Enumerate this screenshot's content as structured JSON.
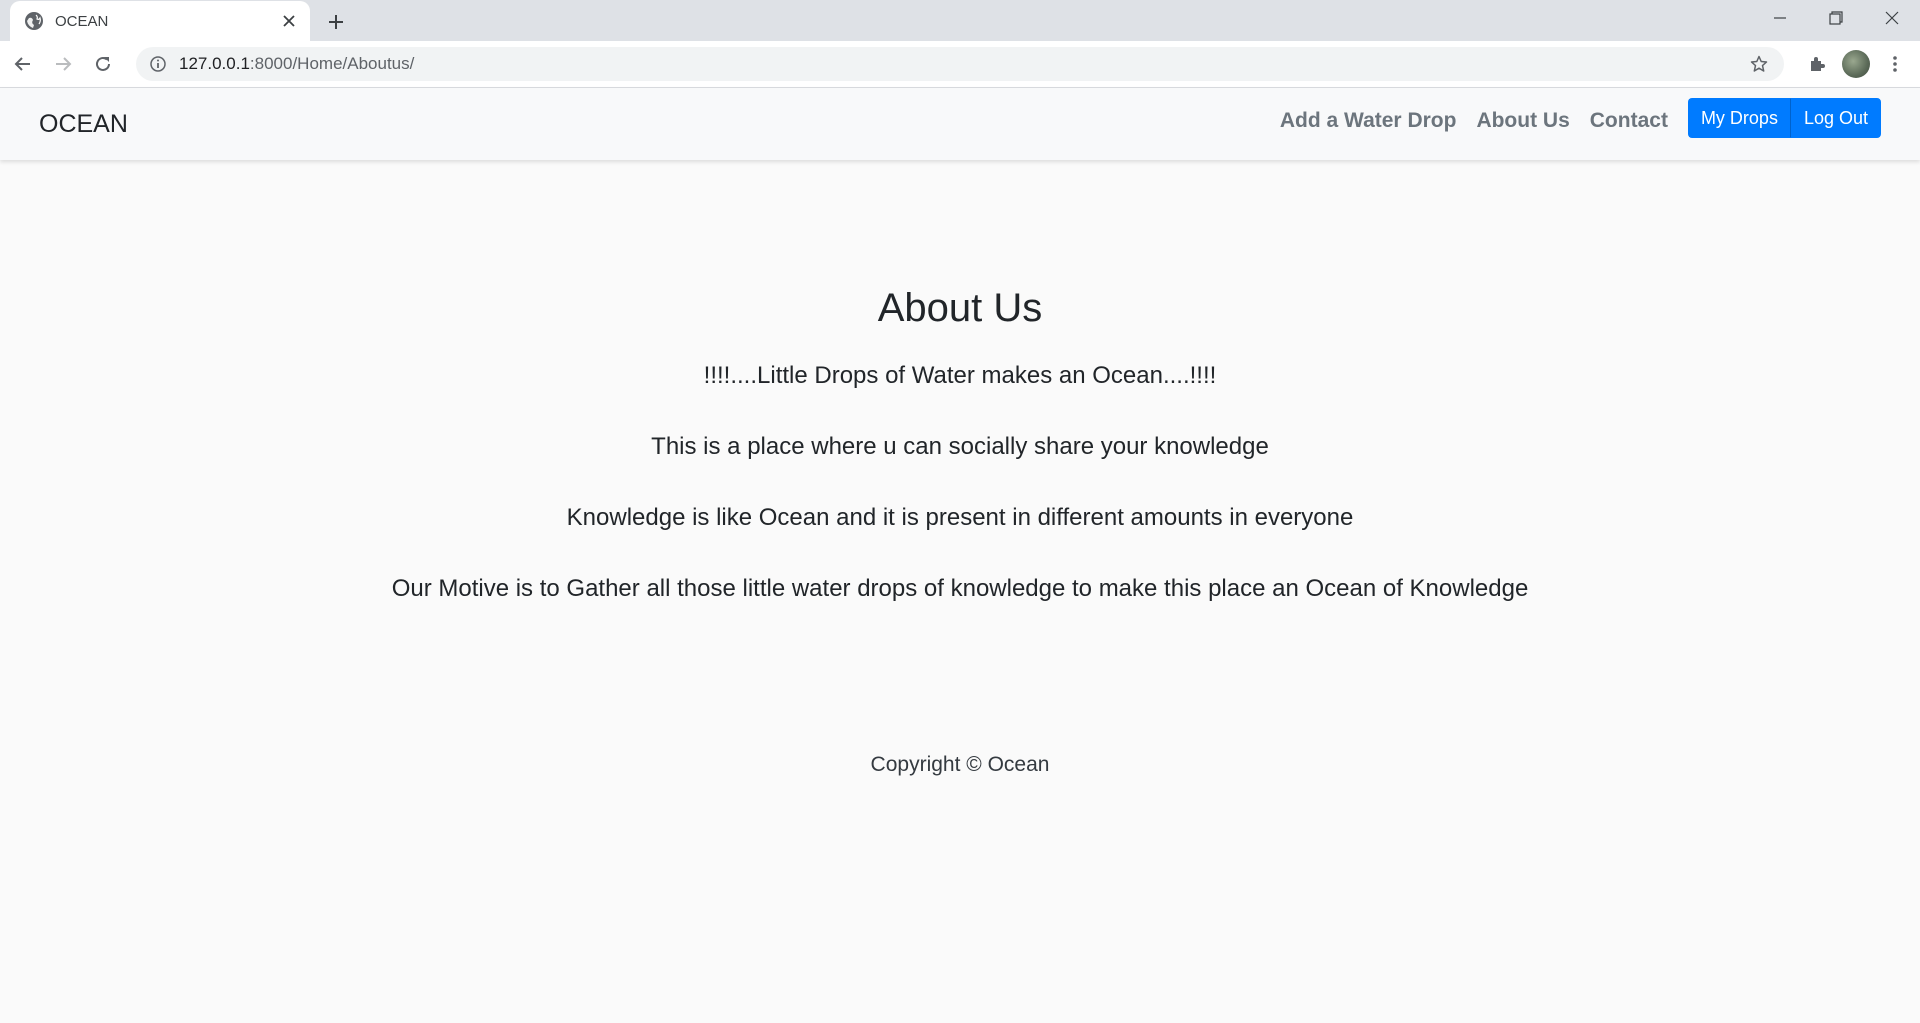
{
  "browser": {
    "tab_title": "OCEAN",
    "url_host": "127.0.0.1",
    "url_path": ":8000/Home/Aboutus/"
  },
  "site": {
    "brand": "OCEAN",
    "nav": {
      "add": "Add a Water Drop",
      "about": "About Us",
      "contact": "Contact",
      "my_drops": "My Drops",
      "logout": "Log Out"
    },
    "accent_color": "#007bff"
  },
  "content": {
    "heading": "About Us",
    "paragraphs": [
      "!!!!....Little Drops of Water makes an Ocean....!!!!",
      "This is a place where u can socially share your knowledge",
      "Knowledge is like Ocean and it is present in different amounts in everyone",
      "Our Motive is to Gather all those little water drops of knowledge to make this place an Ocean of Knowledge"
    ]
  },
  "footer": {
    "copyright": "Copyright © Ocean"
  }
}
